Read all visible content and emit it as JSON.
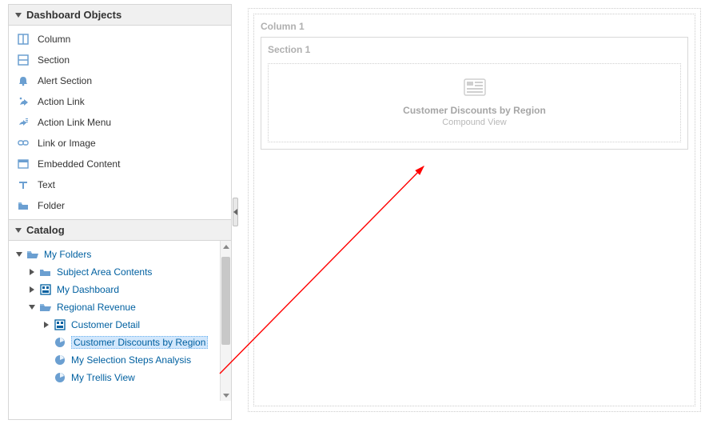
{
  "panels": {
    "dashboard_objects_title": "Dashboard Objects",
    "catalog_title": "Catalog"
  },
  "objects": [
    {
      "icon": "column-icon",
      "label": "Column"
    },
    {
      "icon": "section-icon",
      "label": "Section"
    },
    {
      "icon": "bell-icon",
      "label": "Alert Section"
    },
    {
      "icon": "run-icon",
      "label": "Action Link"
    },
    {
      "icon": "run-menu-icon",
      "label": "Action Link Menu"
    },
    {
      "icon": "link-icon",
      "label": "Link or Image"
    },
    {
      "icon": "embed-icon",
      "label": "Embedded Content"
    },
    {
      "icon": "text-icon",
      "label": "Text"
    },
    {
      "icon": "folder-icon",
      "label": "Folder"
    }
  ],
  "catalog": {
    "root": {
      "label": "My Folders"
    },
    "subject_area": {
      "label": "Subject Area Contents"
    },
    "my_dashboard": {
      "label": "My Dashboard"
    },
    "regional_revenue": {
      "label": "Regional Revenue"
    },
    "customer_detail": {
      "label": "Customer Detail"
    },
    "customer_discounts": {
      "label": "Customer Discounts by Region"
    },
    "selection_steps": {
      "label": "My Selection Steps Analysis"
    },
    "trellis": {
      "label": "My Trellis View"
    }
  },
  "canvas": {
    "column_label": "Column 1",
    "section_label": "Section 1",
    "drop_title": "Customer Discounts by Region",
    "drop_subtitle": "Compound View"
  },
  "colors": {
    "accent": "#6b9fd1",
    "link": "#0060a0"
  }
}
